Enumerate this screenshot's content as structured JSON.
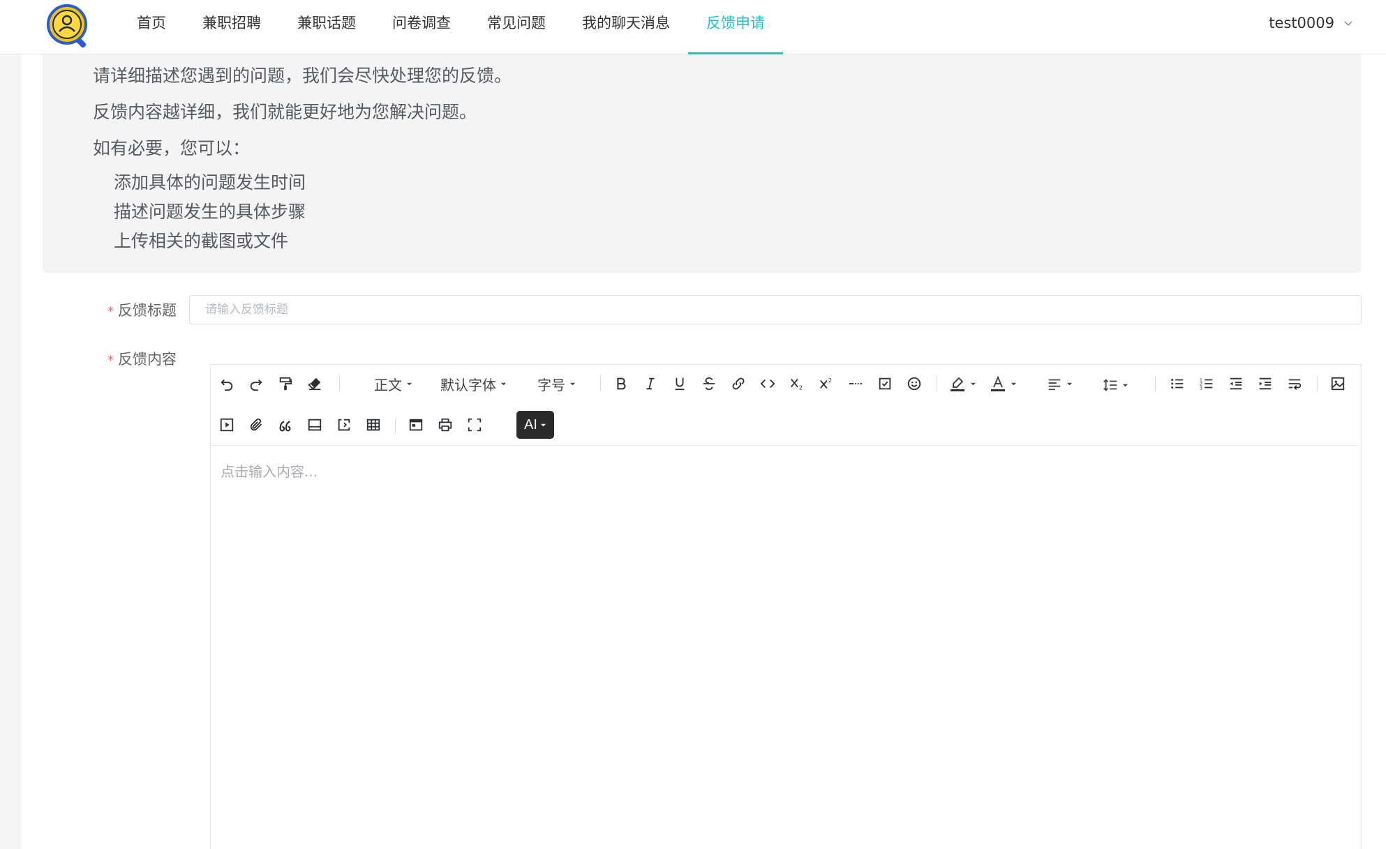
{
  "header": {
    "nav": [
      {
        "label": "首页",
        "active": false
      },
      {
        "label": "兼职招聘",
        "active": false
      },
      {
        "label": "兼职话题",
        "active": false
      },
      {
        "label": "问卷调查",
        "active": false
      },
      {
        "label": "常见问题",
        "active": false
      },
      {
        "label": "我的聊天消息",
        "active": false
      },
      {
        "label": "反馈申请",
        "active": true
      }
    ],
    "username": "test0009"
  },
  "notice": {
    "lines": [
      "请详细描述您遇到的问题，我们会尽快处理您的反馈。",
      "反馈内容越详细，我们就能更好地为您解决问题。",
      "如有必要，您可以："
    ],
    "tips": [
      "添加具体的问题发生时间",
      "描述问题发生的具体步骤",
      "上传相关的截图或文件"
    ]
  },
  "form": {
    "required_mark": "*",
    "title_label": "反馈标题",
    "title_placeholder": "请输入反馈标题",
    "title_value": "",
    "content_label": "反馈内容",
    "content_placeholder": "点击输入内容..."
  },
  "toolbar": {
    "paragraph": "正文",
    "font_family": "默认字体",
    "font_size": "字号",
    "ai": "AI"
  },
  "colors": {
    "accent": "#1ec5c6",
    "required": "#f56c6c"
  }
}
